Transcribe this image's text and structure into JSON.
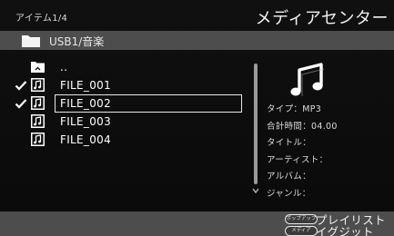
{
  "header": {
    "item_counter": "アイテム1/4",
    "title": "メディアセンター"
  },
  "pathbar": {
    "icon": "folder-icon",
    "path": "USB1/音楽"
  },
  "file_list": [
    {
      "name": "..",
      "icon": "parent-folder-icon",
      "checked": false,
      "selected": false
    },
    {
      "name": "FILE_001",
      "icon": "music-file-icon",
      "checked": true,
      "selected": false
    },
    {
      "name": "FILE_002",
      "icon": "music-file-icon",
      "checked": true,
      "selected": true
    },
    {
      "name": "FILE_003",
      "icon": "music-file-icon",
      "checked": false,
      "selected": false
    },
    {
      "name": "FILE_004",
      "icon": "music-file-icon",
      "checked": false,
      "selected": false
    }
  ],
  "info": {
    "icon": "music-note-icon",
    "type": "タイプ：MP3",
    "duration": "合計時間：04.00",
    "track_title": "タイトル：",
    "artist": "アーティスト：",
    "album": "アルバム：",
    "genre": "ジャンル："
  },
  "footer": {
    "popup_pill": "ポップアップ",
    "playlist_label": "プレイリスト",
    "media_pill": "メディア",
    "digit_label": "イグジット"
  },
  "colors": {
    "background": "#0c0c0c",
    "bar": "#4d4d4d",
    "text": "#ffffff"
  }
}
